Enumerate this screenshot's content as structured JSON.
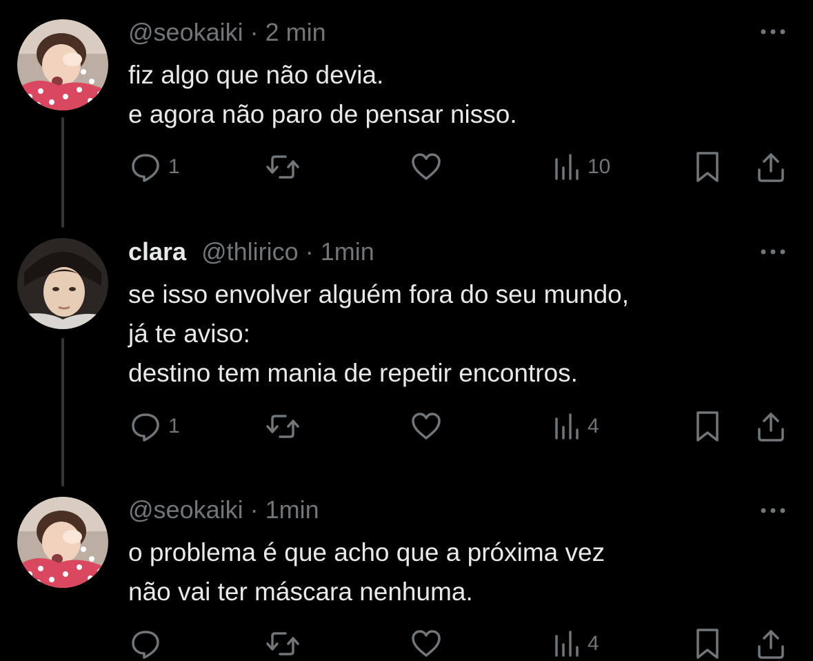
{
  "colors": {
    "background": "#000000",
    "text": "#e7e9ea",
    "muted": "#71767b",
    "thread_line": "#333639"
  },
  "tweets": [
    {
      "display_name": "",
      "handle": "@seokaiki",
      "separator": "·",
      "time": "2 min",
      "lines": [
        "fiz algo que não devia.",
        "e agora não paro de pensar nisso."
      ],
      "replies": "1",
      "retweets": "",
      "likes": "",
      "views": "10",
      "avatar": "avatar-seokaiki"
    },
    {
      "display_name": "clara",
      "handle": "@thlirico",
      "separator": "·",
      "time": "1min",
      "lines": [
        "se isso envolver alguém fora do seu mundo,",
        "já te aviso:",
        "destino tem mania de repetir encontros."
      ],
      "replies": "1",
      "retweets": "",
      "likes": "",
      "views": "4",
      "avatar": "avatar-thlirico"
    },
    {
      "display_name": "",
      "handle": "@seokaiki",
      "separator": "·",
      "time": "1min",
      "lines": [
        "o problema é que acho que a próxima vez",
        "não vai ter máscara nenhuma."
      ],
      "replies": "",
      "retweets": "",
      "likes": "",
      "views": "4",
      "avatar": "avatar-seokaiki"
    }
  ],
  "icons": {
    "reply": "reply-icon",
    "retweet": "retweet-icon",
    "like": "heart-icon",
    "views": "views-icon",
    "bookmark": "bookmark-icon",
    "share": "share-icon",
    "more": "more-icon"
  }
}
